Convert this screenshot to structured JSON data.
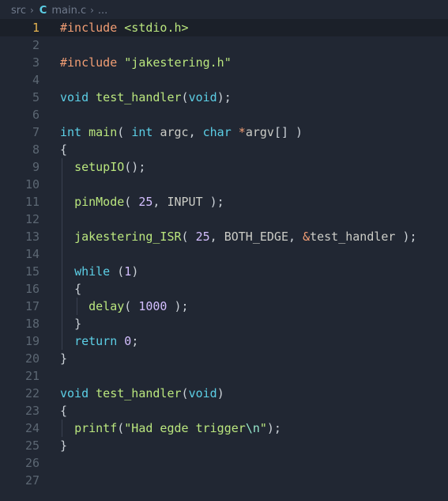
{
  "breadcrumb": {
    "folder": "src",
    "file": "main.c",
    "ellipsis": "...",
    "file_icon": "c-language-icon"
  },
  "active_line": 1,
  "lines": [
    {
      "n": "1",
      "segs": [
        [
          "pp",
          "#include "
        ],
        [
          "inc",
          "<stdio.h>"
        ]
      ]
    },
    {
      "n": "2",
      "segs": []
    },
    {
      "n": "3",
      "segs": [
        [
          "pp",
          "#include "
        ],
        [
          "inc",
          "\"jakestering.h\""
        ]
      ]
    },
    {
      "n": "4",
      "segs": []
    },
    {
      "n": "5",
      "segs": [
        [
          "kw",
          "void "
        ],
        [
          "fn",
          "test_handler"
        ],
        [
          "pun",
          "("
        ],
        [
          "kw",
          "void"
        ],
        [
          "pun",
          ");"
        ]
      ]
    },
    {
      "n": "6",
      "segs": []
    },
    {
      "n": "7",
      "segs": [
        [
          "kw",
          "int "
        ],
        [
          "fn",
          "main"
        ],
        [
          "pun",
          "( "
        ],
        [
          "kw",
          "int "
        ],
        [
          "plain",
          "argc"
        ],
        [
          "pun",
          ", "
        ],
        [
          "kw",
          "char "
        ],
        [
          "op",
          "*"
        ],
        [
          "plain",
          "argv"
        ],
        [
          "pun",
          "[] )"
        ]
      ]
    },
    {
      "n": "8",
      "segs": [
        [
          "pun",
          "{"
        ]
      ]
    },
    {
      "n": "9",
      "segs": [
        [
          "plain",
          "  "
        ],
        [
          "fn",
          "setupIO"
        ],
        [
          "pun",
          "();"
        ]
      ]
    },
    {
      "n": "10",
      "segs": []
    },
    {
      "n": "11",
      "segs": [
        [
          "plain",
          "  "
        ],
        [
          "fn",
          "pinMode"
        ],
        [
          "pun",
          "( "
        ],
        [
          "num",
          "25"
        ],
        [
          "pun",
          ", "
        ],
        [
          "plain",
          "INPUT "
        ],
        [
          "pun",
          ");"
        ]
      ]
    },
    {
      "n": "12",
      "segs": []
    },
    {
      "n": "13",
      "segs": [
        [
          "plain",
          "  "
        ],
        [
          "fn",
          "jakestering_ISR"
        ],
        [
          "pun",
          "( "
        ],
        [
          "num",
          "25"
        ],
        [
          "pun",
          ", "
        ],
        [
          "plain",
          "BOTH_EDGE"
        ],
        [
          "pun",
          ", "
        ],
        [
          "op",
          "&"
        ],
        [
          "plain",
          "test_handler "
        ],
        [
          "pun",
          ");"
        ]
      ]
    },
    {
      "n": "14",
      "segs": []
    },
    {
      "n": "15",
      "segs": [
        [
          "plain",
          "  "
        ],
        [
          "kw",
          "while "
        ],
        [
          "pun",
          "("
        ],
        [
          "num",
          "1"
        ],
        [
          "pun",
          ")"
        ]
      ]
    },
    {
      "n": "16",
      "segs": [
        [
          "plain",
          "  "
        ],
        [
          "pun",
          "{"
        ]
      ]
    },
    {
      "n": "17",
      "segs": [
        [
          "plain",
          "    "
        ],
        [
          "fn",
          "delay"
        ],
        [
          "pun",
          "( "
        ],
        [
          "num",
          "1000"
        ],
        [
          "pun",
          " );"
        ]
      ]
    },
    {
      "n": "18",
      "segs": [
        [
          "plain",
          "  "
        ],
        [
          "pun",
          "}"
        ]
      ]
    },
    {
      "n": "19",
      "segs": [
        [
          "plain",
          "  "
        ],
        [
          "kw",
          "return "
        ],
        [
          "num",
          "0"
        ],
        [
          "pun",
          ";"
        ]
      ]
    },
    {
      "n": "20",
      "segs": [
        [
          "pun",
          "}"
        ]
      ]
    },
    {
      "n": "21",
      "segs": []
    },
    {
      "n": "22",
      "segs": [
        [
          "kw",
          "void "
        ],
        [
          "fn",
          "test_handler"
        ],
        [
          "pun",
          "("
        ],
        [
          "kw",
          "void"
        ],
        [
          "pun",
          ")"
        ]
      ]
    },
    {
      "n": "23",
      "segs": [
        [
          "pun",
          "{"
        ]
      ]
    },
    {
      "n": "24",
      "segs": [
        [
          "plain",
          "  "
        ],
        [
          "fn",
          "printf"
        ],
        [
          "pun",
          "("
        ],
        [
          "str",
          "\"Had egde trigger"
        ],
        [
          "esc",
          "\\n"
        ],
        [
          "str",
          "\""
        ],
        [
          "pun",
          ");"
        ]
      ]
    },
    {
      "n": "25",
      "segs": [
        [
          "pun",
          "}"
        ]
      ]
    },
    {
      "n": "26",
      "segs": []
    },
    {
      "n": "27",
      "segs": []
    }
  ],
  "colors": {
    "background": "#212733",
    "keyword": "#5ccfe6",
    "function": "#bae67e",
    "number": "#d4bfff",
    "preprocessor": "#f29e74",
    "line_number": "#5c6773",
    "active_line_number": "#e6b450"
  }
}
